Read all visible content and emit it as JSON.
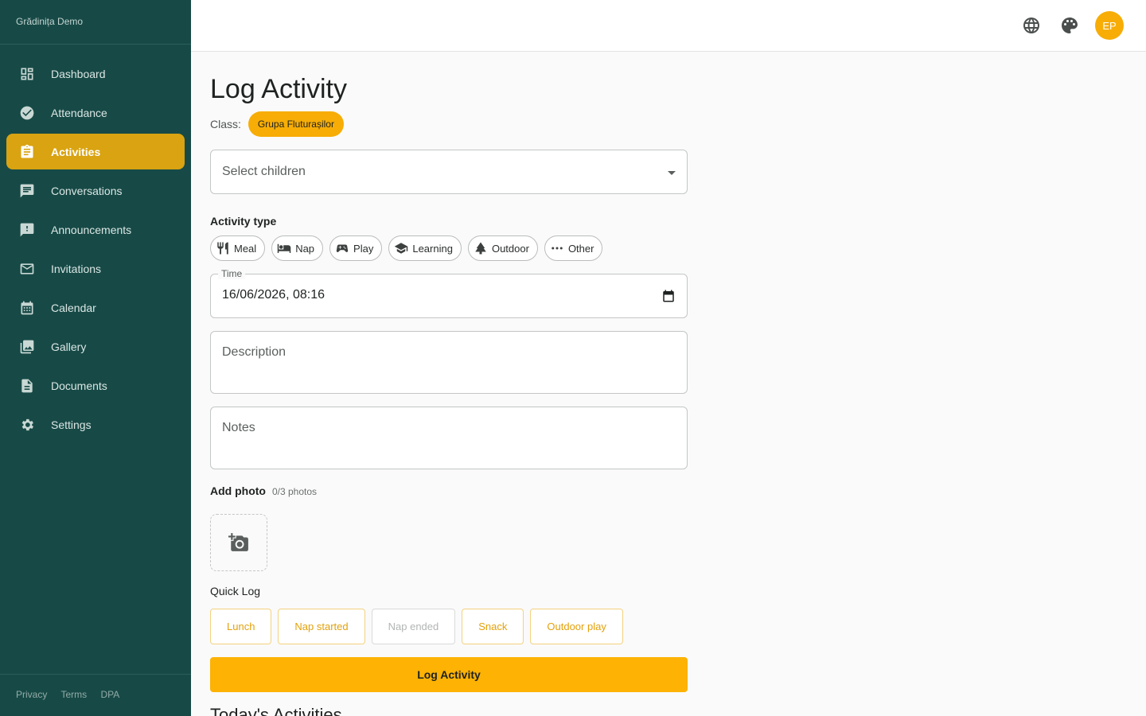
{
  "sidebar": {
    "brand": "Grădinița Demo",
    "items": [
      {
        "label": "Dashboard",
        "icon": "dashboard-icon"
      },
      {
        "label": "Attendance",
        "icon": "check-circle-icon"
      },
      {
        "label": "Activities",
        "icon": "clipboard-icon",
        "active": true
      },
      {
        "label": "Conversations",
        "icon": "chat-icon"
      },
      {
        "label": "Announcements",
        "icon": "announcement-icon"
      },
      {
        "label": "Invitations",
        "icon": "mail-icon"
      },
      {
        "label": "Calendar",
        "icon": "calendar-icon"
      },
      {
        "label": "Gallery",
        "icon": "gallery-icon"
      },
      {
        "label": "Documents",
        "icon": "document-icon"
      },
      {
        "label": "Settings",
        "icon": "gear-icon"
      }
    ],
    "footer": {
      "privacy": "Privacy",
      "terms": "Terms",
      "dpa": "DPA"
    }
  },
  "topbar": {
    "avatar_initials": "EP",
    "icons": [
      "globe-icon",
      "palette-icon"
    ]
  },
  "page": {
    "title": "Log Activity",
    "class_label": "Class:",
    "class_name": "Grupa Fluturașilor",
    "select_children_placeholder": "Select children",
    "activity_type_label": "Activity type",
    "activity_types": [
      {
        "label": "Meal",
        "icon": "cutlery-icon"
      },
      {
        "label": "Nap",
        "icon": "bed-icon"
      },
      {
        "label": "Play",
        "icon": "gamepad-icon"
      },
      {
        "label": "Learning",
        "icon": "school-icon"
      },
      {
        "label": "Outdoor",
        "icon": "tree-icon"
      },
      {
        "label": "Other",
        "icon": "more-icon"
      }
    ],
    "time_label": "Time",
    "time_value": "16/06/2026, 08:16",
    "description_placeholder": "Description",
    "notes_placeholder": "Notes",
    "add_photo_label": "Add photo",
    "photo_count": "0/3 photos",
    "quick_log_label": "Quick Log",
    "quick_log": [
      {
        "label": "Lunch",
        "disabled": false
      },
      {
        "label": "Nap started",
        "disabled": false
      },
      {
        "label": "Nap ended",
        "disabled": true
      },
      {
        "label": "Snack",
        "disabled": false
      },
      {
        "label": "Outdoor play",
        "disabled": false
      }
    ],
    "submit_label": "Log Activity",
    "today_title": "Today's Activities"
  },
  "colors": {
    "sidebar_bg": "#174a47",
    "accent": "#fdb204",
    "active_nav": "#d9a312"
  }
}
